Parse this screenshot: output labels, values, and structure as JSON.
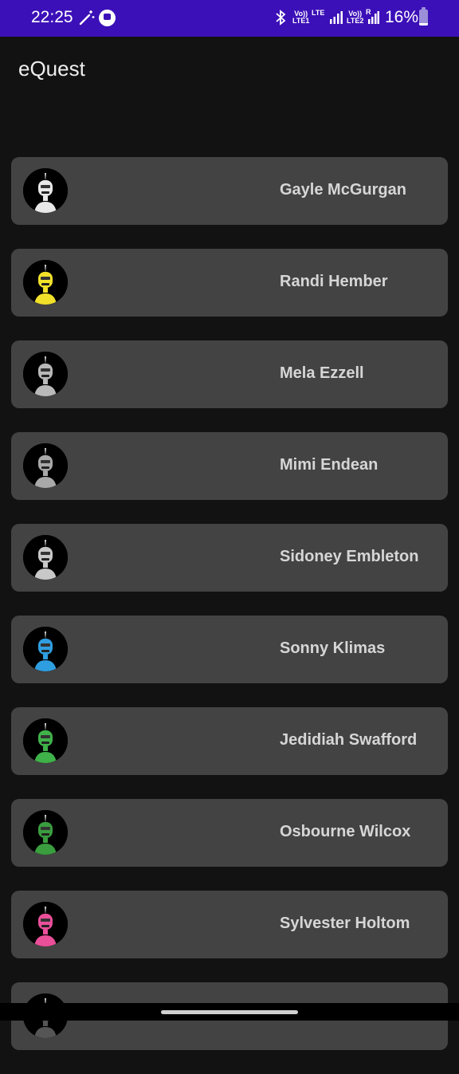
{
  "status_bar": {
    "time": "22:25",
    "volte1": "Vo))\nLTE1",
    "lte": "LTE",
    "volte2": "Vo))\nLTE2",
    "roaming": "R",
    "battery_percent": "16%",
    "battery_level": 0.16,
    "background": "#3c10b8",
    "icons": [
      "magic-wand-icon",
      "app-notification-icon",
      "bluetooth-icon",
      "signal-icon",
      "signal-icon",
      "battery-icon"
    ]
  },
  "app_bar": {
    "title": "eQuest"
  },
  "users": [
    {
      "name": "Gayle McGurgan",
      "avatar_color": "#e8e8e8"
    },
    {
      "name": "Randi Hember",
      "avatar_color": "#f2e12a"
    },
    {
      "name": "Mela Ezzell",
      "avatar_color": "#b9b9b9"
    },
    {
      "name": "Mimi Endean",
      "avatar_color": "#a9a9a9"
    },
    {
      "name": "Sidoney Embleton",
      "avatar_color": "#c8c8c8"
    },
    {
      "name": "Sonny Klimas",
      "avatar_color": "#2f9ee0"
    },
    {
      "name": "Jedidiah Swafford",
      "avatar_color": "#3fb24a"
    },
    {
      "name": "Osbourne Wilcox",
      "avatar_color": "#3a9d3e"
    },
    {
      "name": "Sylvester Holtom",
      "avatar_color": "#ea4f9a"
    },
    {
      "name": "",
      "avatar_color": "#555555"
    }
  ],
  "colors": {
    "background": "#121212",
    "card": "#434343",
    "name_text": "#d6d6d6",
    "title_text": "#eeeeee"
  }
}
